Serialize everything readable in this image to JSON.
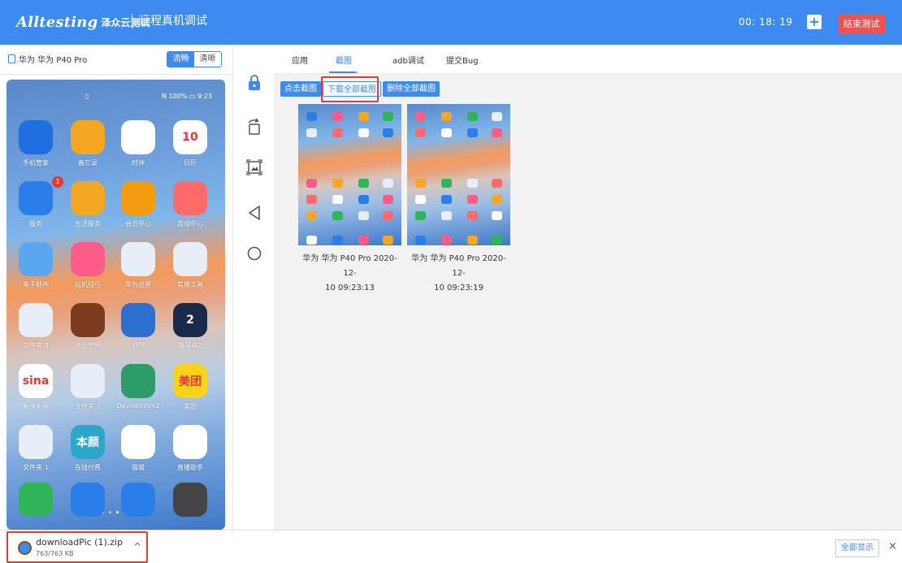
{
  "header": {
    "logo_word": "Alltesting",
    "logo_cn": "泽众云测试",
    "title": "远程真机调试",
    "timer": "00:  18:  19",
    "add_symbol": "+",
    "end_button": "结束测试"
  },
  "device": {
    "name": "华为 华为 P40 Pro",
    "quality_options": [
      "流畅",
      "清晰"
    ],
    "quality_selected": "流畅"
  },
  "phone": {
    "status_left": "▯",
    "status_right": "N 100% ▭ 9:23",
    "apps": [
      {
        "label": "手机管家",
        "glyph": "",
        "color": "#1f6fe0",
        "badge": ""
      },
      {
        "label": "备忘录",
        "glyph": "",
        "color": "#f5a623",
        "badge": ""
      },
      {
        "label": "时钟",
        "glyph": "",
        "color": "#ffffff",
        "badge": ""
      },
      {
        "label": "日历",
        "glyph": "10",
        "color": "#ffffff",
        "badge": ""
      },
      {
        "label": "服务",
        "glyph": "",
        "color": "#2b7de9",
        "badge": "1"
      },
      {
        "label": "生活服务",
        "glyph": "",
        "color": "#f5a623",
        "badge": ""
      },
      {
        "label": "会员中心",
        "glyph": "",
        "color": "#f39c12",
        "badge": ""
      },
      {
        "label": "游戏中心",
        "glyph": "",
        "color": "#ff6b6b",
        "badge": ""
      },
      {
        "label": "电子邮件",
        "glyph": "",
        "color": "#5aa7ef",
        "badge": ""
      },
      {
        "label": "玩机技巧",
        "glyph": "",
        "color": "#ff5c8a",
        "badge": ""
      },
      {
        "label": "华为应用",
        "glyph": "",
        "color": "#e8eef7",
        "badge": ""
      },
      {
        "label": "实用工具",
        "glyph": "",
        "color": "#e8eef7",
        "badge": ""
      },
      {
        "label": "文件夹 3",
        "glyph": "",
        "color": "#e8eef7",
        "badge": ""
      },
      {
        "label": "创造世界",
        "glyph": "",
        "color": "#7a3b1e",
        "badge": ""
      },
      {
        "label": "VPN",
        "glyph": "",
        "color": "#2d6fcf",
        "badge": ""
      },
      {
        "label": "钢琴块2",
        "glyph": "2",
        "color": "#1c2a4a",
        "badge": ""
      },
      {
        "label": "新浪新闻",
        "glyph": "sina",
        "color": "#ffffff",
        "badge": ""
      },
      {
        "label": "文件夹 2",
        "glyph": "",
        "color": "#e8eef7",
        "badge": ""
      },
      {
        "label": "DeviceInfoV2",
        "glyph": "",
        "color": "#2e9b6a",
        "badge": ""
      },
      {
        "label": "美团",
        "glyph": "美团",
        "color": "#ffd31a",
        "badge": ""
      },
      {
        "label": "文件夹 1",
        "glyph": "",
        "color": "#e8eef7",
        "badge": ""
      },
      {
        "label": "在线付费",
        "glyph": "本颜",
        "color": "#2aa7c9",
        "badge": ""
      },
      {
        "label": "猫猫",
        "glyph": "",
        "color": "#ffffff",
        "badge": ""
      },
      {
        "label": "直播助手",
        "glyph": "",
        "color": "#ffffff",
        "badge": ""
      }
    ],
    "dock": [
      {
        "label": "phone",
        "color": "#2fb45a"
      },
      {
        "label": "messages",
        "color": "#2b7de9"
      },
      {
        "label": "browser",
        "color": "#2b7de9"
      },
      {
        "label": "camera",
        "color": "#444444"
      }
    ]
  },
  "tabs": [
    {
      "label": "应用",
      "active": false
    },
    {
      "label": "截图",
      "active": true
    },
    {
      "label": "adb调试",
      "active": false
    },
    {
      "label": "提交Bug",
      "active": false
    }
  ],
  "actions": {
    "capture": "点击截图",
    "download_all": "下载全部截图",
    "delete_all": "删除全部截图"
  },
  "screenshots": [
    {
      "caption_line1": "华为 华为 P40 Pro  2020-12-",
      "caption_line2": "10 09:23:13"
    },
    {
      "caption_line1": "华为 华为 P40 Pro  2020-12-",
      "caption_line2": "10 09:23:19"
    }
  ],
  "download_bar": {
    "filename": "downloadPic (1).zip",
    "size": "763/763 KB",
    "show_all": "全部显示",
    "close": "×",
    "expand": "^"
  },
  "colors": {
    "accent": "#3d8bf0",
    "danger": "#ef5350",
    "highlight": "#e53935"
  }
}
